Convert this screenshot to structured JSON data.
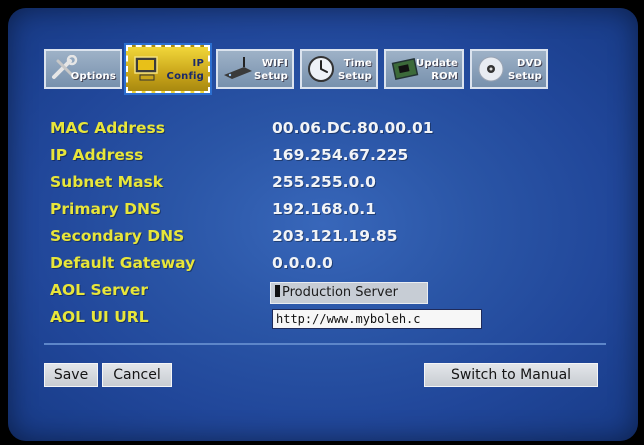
{
  "tabs": [
    {
      "id": "options",
      "line1": "",
      "line2": "Options",
      "icon": "tools-icon"
    },
    {
      "id": "ip-config",
      "line1": "IP",
      "line2": "Config",
      "icon": "computer-icon",
      "active": true
    },
    {
      "id": "wifi-setup",
      "line1": "WIFI",
      "line2": "Setup",
      "icon": "router-icon"
    },
    {
      "id": "time-setup",
      "line1": "Time",
      "line2": "Setup",
      "icon": "clock-icon"
    },
    {
      "id": "update-rom",
      "line1": "Update",
      "line2": "ROM",
      "icon": "chip-icon"
    },
    {
      "id": "dvd-setup",
      "line1": "DVD",
      "line2": "Setup",
      "icon": "disc-icon"
    }
  ],
  "fields": {
    "mac": {
      "label": "MAC Address",
      "value": "00.06.DC.80.00.01"
    },
    "ip": {
      "label": "IP Address",
      "value": "169.254.67.225"
    },
    "subnet": {
      "label": "Subnet Mask",
      "value": "255.255.0.0"
    },
    "dns1": {
      "label": "Primary DNS",
      "value": "192.168.0.1"
    },
    "dns2": {
      "label": "Secondary DNS",
      "value": "203.121.19.85"
    },
    "gateway": {
      "label": "Default Gateway",
      "value": "0.0.0.0"
    },
    "aol_server": {
      "label": "AOL Server",
      "value": "Production Server"
    },
    "aol_url": {
      "label": "AOL UI URL",
      "value": "http://www.myboleh.c"
    }
  },
  "buttons": {
    "save": "Save",
    "cancel": "Cancel",
    "switch": "Switch to Manual"
  },
  "colors": {
    "label": "#e8e63a",
    "value": "#f2f4f7",
    "background": "#2a55a6",
    "active_tab": "#e2c42c"
  }
}
